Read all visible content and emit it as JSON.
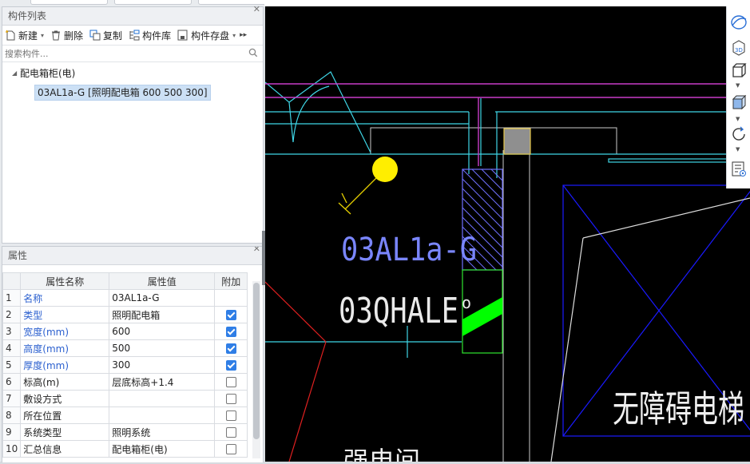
{
  "component_list": {
    "title": "构件列表",
    "toolbar": {
      "new_label": "新建",
      "delete_label": "删除",
      "copy_label": "复制",
      "library_label": "构件库",
      "save_label": "构件存盘"
    },
    "search_placeholder": "搜索构件...",
    "tree": {
      "group_label": "配电箱柜(电)",
      "selected_item": "03AL1a-G [照明配电箱 600 500 300]"
    }
  },
  "properties": {
    "title": "属性",
    "headers": {
      "name": "属性名称",
      "value": "属性值",
      "extra": "附加"
    },
    "rows": [
      {
        "num": "1",
        "name": "名称",
        "value": "03AL1a-G",
        "checked": null
      },
      {
        "num": "2",
        "name": "类型",
        "value": "照明配电箱",
        "checked": true
      },
      {
        "num": "3",
        "name": "宽度(mm)",
        "value": "600",
        "checked": true
      },
      {
        "num": "4",
        "name": "高度(mm)",
        "value": "500",
        "checked": true
      },
      {
        "num": "5",
        "name": "厚度(mm)",
        "value": "300",
        "checked": true
      },
      {
        "num": "6",
        "name": "标高(m)",
        "value": "层底标高+1.4",
        "checked": false
      },
      {
        "num": "7",
        "name": "敷设方式",
        "value": "",
        "checked": false
      },
      {
        "num": "8",
        "name": "所在位置",
        "value": "",
        "checked": false
      },
      {
        "num": "9",
        "name": "系统类型",
        "value": "照明系统",
        "checked": false
      },
      {
        "num": "10",
        "name": "汇总信息",
        "value": "配电箱柜(电)",
        "checked": false
      }
    ]
  },
  "cad": {
    "label_panel": "03AL1a-G",
    "label_device": "03QHALE",
    "label_device_trail": "o",
    "label_elevator": "无障碍电梯",
    "label_bottom": "强电间"
  },
  "colors": {
    "cad_background": "#000000",
    "cyan": "#3fd6e6",
    "magenta": "#c83cc8",
    "blue": "#1a1aff",
    "green_fill": "#00ff00",
    "yellow_dot": "#ffee00"
  },
  "icons": [
    "new-icon",
    "delete-icon",
    "copy-icon",
    "library-icon",
    "save-icon",
    "search-icon",
    "orbit-icon",
    "view-3d-icon",
    "cube-icon",
    "cube-solid-icon",
    "rotate-icon",
    "list-view-icon"
  ]
}
